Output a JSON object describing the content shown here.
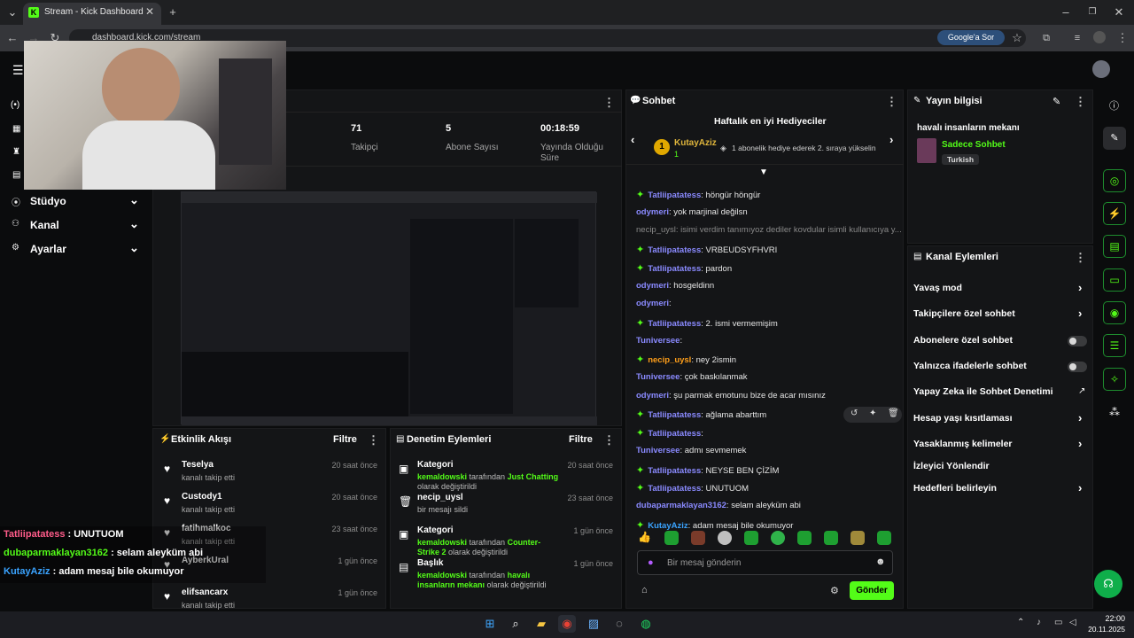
{
  "browser": {
    "tab_title": "Stream - Kick Dashboard",
    "url": "dashboard.kick.com/stream",
    "google_button": "Google'a Sor"
  },
  "sidebar": {
    "items": [
      {
        "label": "Stüdyo"
      },
      {
        "label": "Kanal"
      },
      {
        "label": "Ayarlar"
      }
    ]
  },
  "stats": [
    {
      "value": "71",
      "label": "Takipçi"
    },
    {
      "value": "5",
      "label": "Abone Sayısı"
    },
    {
      "value": "00:18:59",
      "label": "Yayında Olduğu Süre"
    }
  ],
  "activity_feed": {
    "title": "Etkinlik Akışı",
    "filter": "Filtre",
    "items": [
      {
        "name": "Teselya",
        "sub": "kanalı takip etti",
        "time": "20 saat önce"
      },
      {
        "name": "Custody1",
        "sub": "kanalı takip etti",
        "time": "20 saat önce"
      },
      {
        "name": "fatihmalkoc",
        "sub": "kanalı takip etti",
        "time": "23 saat önce"
      },
      {
        "name": "AyberkUral",
        "sub": "",
        "time": "1 gün önce"
      },
      {
        "name": "elifsancarx",
        "sub": "kanalı takip etti",
        "time": "1 gün önce"
      }
    ]
  },
  "mod_actions": {
    "title": "Denetim Eylemleri",
    "filter": "Filtre",
    "items": [
      {
        "title": "Kategori",
        "user": "kemaldowski",
        "mid": " tarafından ",
        "highlight": "Just Chatting",
        "tail": " olarak değiştirildi",
        "time": "20 saat önce"
      },
      {
        "title": "necip_uysl",
        "user": "",
        "mid": "bir mesajı sildi",
        "highlight": "",
        "tail": "",
        "time": "23 saat önce"
      },
      {
        "title": "Kategori",
        "user": "kemaldowski",
        "mid": " tarafından ",
        "highlight": "Counter-Strike 2",
        "tail": " olarak değiştirildi",
        "time": "1 gün önce"
      },
      {
        "title": "Başlık",
        "user": "kemaldowski",
        "mid": " tarafından ",
        "highlight": "havalı insanların mekanı",
        "tail": " olarak değiştirildi",
        "time": "1 gün önce"
      }
    ]
  },
  "chat": {
    "title": "Sohbet",
    "gifters_title": "Haftalık en iyi Hediyeciler",
    "gifter_name": "KutayAziz",
    "gifter_count": "1",
    "gifter_note": "1 abonelik hediye ederek 2. sıraya yükselin",
    "messages": [
      {
        "user": "Tatliipatatess",
        "text": "höngür höngür",
        "color": "#8a8aff",
        "star": true
      },
      {
        "user": "odymeri",
        "text": "yok marjinal değilsn",
        "color": "#8a8aff",
        "star": false
      },
      {
        "user": "",
        "text": "necip_uysl: isimi verdim tanımıyoz dediler kovdular isimli kullanıcıya y...",
        "color": "#888888",
        "star": false
      },
      {
        "user": "Tatliipatatess",
        "text": "VRBEUDSYFHVRI",
        "color": "#8a8aff",
        "star": true
      },
      {
        "user": "Tatliipatatess",
        "text": "pardon",
        "color": "#8a8aff",
        "star": true
      },
      {
        "user": "odymeri",
        "text": "hosgeldinn",
        "color": "#8a8aff",
        "star": false
      },
      {
        "user": "odymeri",
        "text": "",
        "color": "#8a8aff",
        "star": false
      },
      {
        "user": "Tatliipatatess",
        "text": "2. ismi vermemişim",
        "color": "#8a8aff",
        "star": true
      },
      {
        "user": "Tuniversee",
        "text": "",
        "color": "#8a8aff",
        "star": false
      },
      {
        "user": "necip_uysl",
        "text": "ney 2ismin",
        "color": "#ff9f1a",
        "star": true
      },
      {
        "user": "Tuniversee",
        "text": "çok baskılanmak",
        "color": "#8a8aff",
        "star": false
      },
      {
        "user": "odymeri",
        "text": "şu parmak emotunu bize de acar mısınız",
        "color": "#8a8aff",
        "star": false
      },
      {
        "user": "Tatliipatatess",
        "text": "ağlama abarttım",
        "color": "#8a8aff",
        "star": true
      },
      {
        "user": "Tatliipatatess",
        "text": "",
        "color": "#8a8aff",
        "star": true
      },
      {
        "user": "Tuniversee",
        "text": "admı sevmemek",
        "color": "#8a8aff",
        "star": false
      },
      {
        "user": "Tatliipatatess",
        "text": "NEYSE BEN ÇİZİM",
        "color": "#8a8aff",
        "star": true
      },
      {
        "user": "Tatliipatatess",
        "text": "UNUTUOM",
        "color": "#8a8aff",
        "star": true
      },
      {
        "user": "dubaparmaklayan3162",
        "text": "selam aleyküm abi",
        "color": "#8a8aff",
        "star": false
      },
      {
        "user": "KutayAziz",
        "text": "adam mesaj bile okumuyor",
        "color": "#3aa3ff",
        "star": true
      }
    ],
    "input_placeholder": "Bir mesaj gönderin",
    "send_label": "Gönder"
  },
  "stream_info": {
    "title": "Yayın bilgisi",
    "stream_title": "havalı insanların mekanı",
    "category": "Sadece Sohbet",
    "language": "Turkish"
  },
  "channel_actions": {
    "title": "Kanal Eylemleri",
    "items": [
      {
        "label": "Yavaş mod",
        "control": "chevron"
      },
      {
        "label": "Takipçilere özel sohbet",
        "control": "chevron"
      },
      {
        "label": "Abonelere özel sohbet",
        "control": "toggle"
      },
      {
        "label": "Yalnızca ifadelerle sohbet",
        "control": "toggle"
      },
      {
        "label": "Yapay Zeka ile Sohbet Denetimi",
        "control": "external"
      },
      {
        "label": "Hesap yaşı kısıtlaması",
        "control": "chevron"
      },
      {
        "label": "Yasaklanmış kelimeler",
        "control": "chevron"
      },
      {
        "label": "İzleyici Yönlendir",
        "control": "none"
      },
      {
        "label": "Hedefleri belirleyin",
        "control": "chevron"
      }
    ]
  },
  "overlay_chat": [
    {
      "user": "Tatliipatatess",
      "text": " : UNUTUOM",
      "color": "#ff5c8a"
    },
    {
      "user": "dubaparmaklayan3162",
      "text": " : selam aleyküm abi",
      "color": "#53fc18"
    },
    {
      "user": "KutayAziz",
      "text": " : adam mesaj bile okumuyor",
      "color": "#3aa3ff"
    }
  ],
  "taskbar": {
    "time": "22:00",
    "date": "20.11.2025"
  },
  "colors": {
    "accent": "#53fc18",
    "panel": "#141517",
    "bg": "#0b0c0d"
  }
}
